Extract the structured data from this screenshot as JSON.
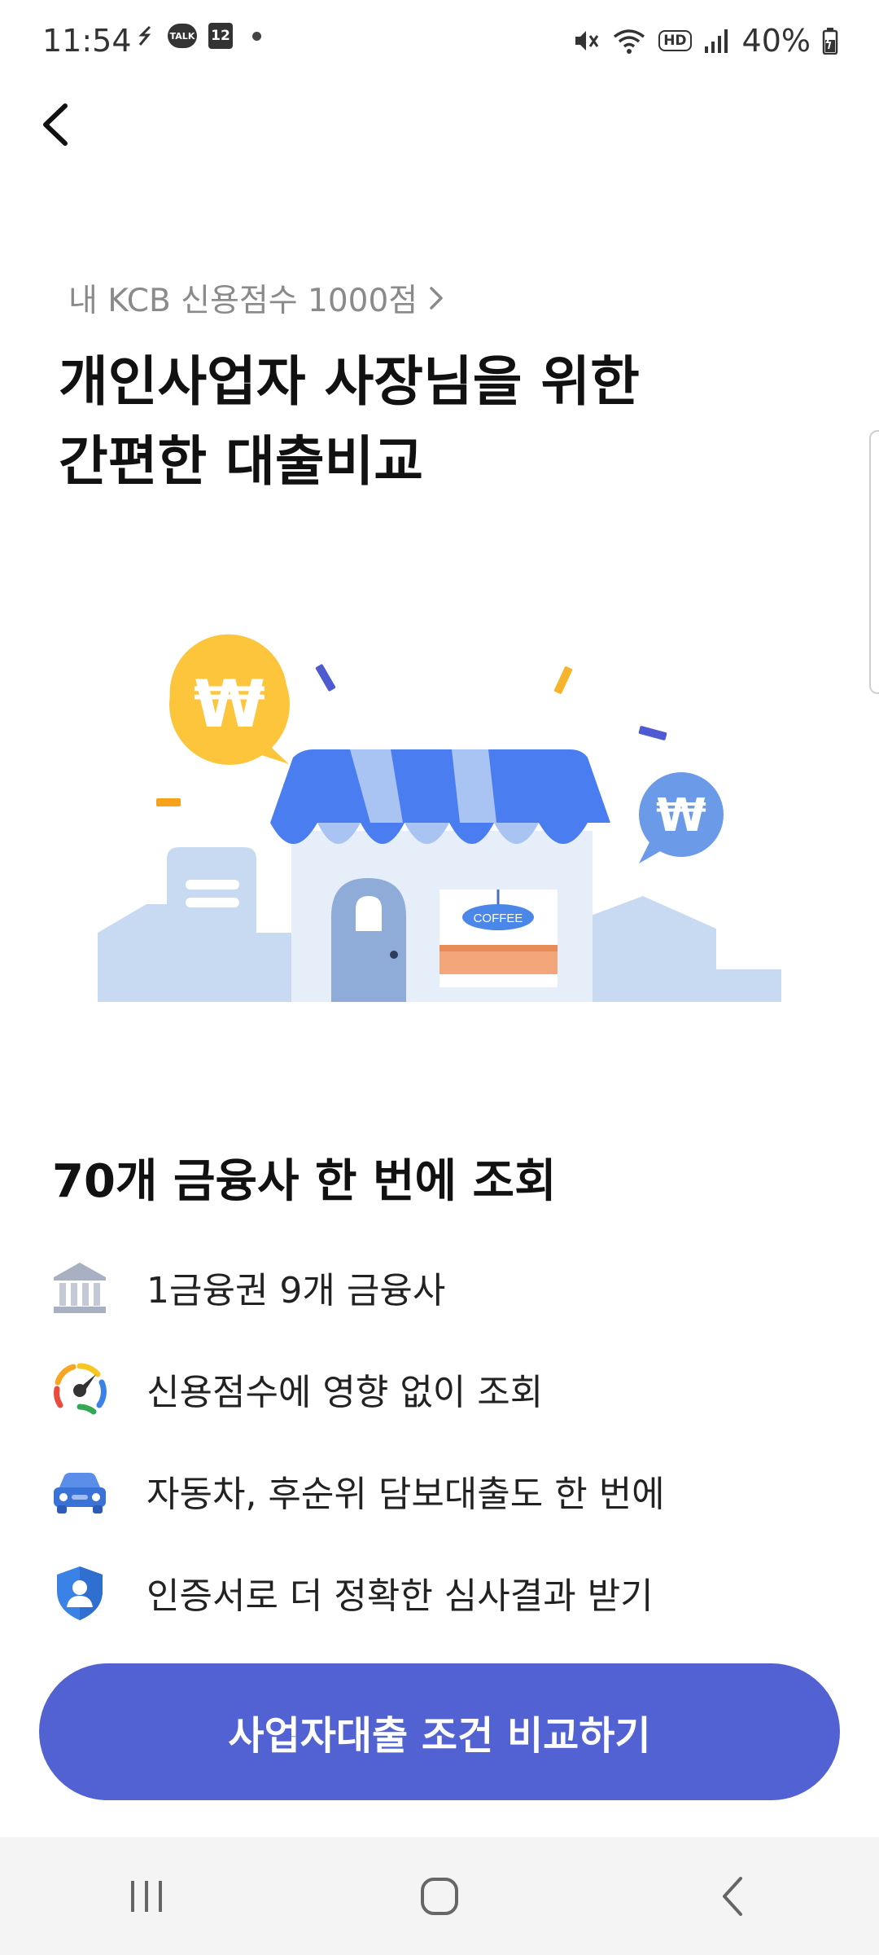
{
  "status_bar": {
    "time": "11:54",
    "talk_label": "TALK",
    "calendar_day": "12",
    "hd_label": "HD",
    "battery": "40%"
  },
  "header": {
    "back_icon": "chevron-left-icon"
  },
  "credit": {
    "score_text": "내 KCB 신용점수 1000점"
  },
  "headline": {
    "line1": "개인사업자 사장님을 위한",
    "line2": "간편한 대출비교"
  },
  "illustration": {
    "sign_text": "COFFEE",
    "currency_symbol": "₩"
  },
  "section": {
    "title": "70개 금융사 한 번에 조회"
  },
  "features": [
    {
      "icon": "bank-icon",
      "label": "1금융권 9개 금융사"
    },
    {
      "icon": "speedometer-icon",
      "label": "신용점수에 영향 없이 조회"
    },
    {
      "icon": "car-icon",
      "label": "자동차, 후순위 담보대출도 한 번에"
    },
    {
      "icon": "shield-user-icon",
      "label": "인증서로 더 정확한 심사결과 받기"
    }
  ],
  "cta": {
    "label": "사업자대출 조건 비교하기"
  },
  "colors": {
    "primary": "#5262d2",
    "awning_blue": "#4a7ef0",
    "coin_yellow": "#fcc53c",
    "building_light": "#c8daf2"
  }
}
